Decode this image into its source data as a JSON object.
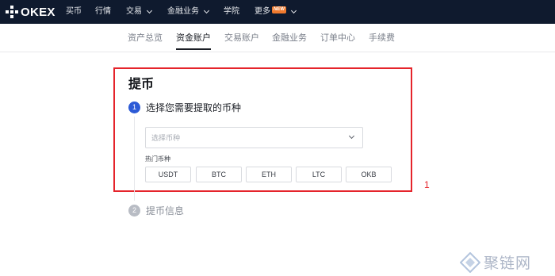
{
  "topnav": {
    "logo_text": "OKEX",
    "items": [
      {
        "label": "买币"
      },
      {
        "label": "行情"
      },
      {
        "label": "交易"
      },
      {
        "label": "金融业务"
      },
      {
        "label": "学院"
      },
      {
        "label": "更多"
      }
    ],
    "new_badge": "NEW"
  },
  "subnav": {
    "tabs": [
      {
        "label": "资产总览"
      },
      {
        "label": "资金账户",
        "active": true
      },
      {
        "label": "交易账户"
      },
      {
        "label": "金融业务"
      },
      {
        "label": "订单中心"
      },
      {
        "label": "手续费"
      }
    ]
  },
  "withdraw": {
    "title": "提币",
    "step1": {
      "number": "1",
      "label": "选择您需要提取的币种"
    },
    "select": {
      "placeholder": "选择币种"
    },
    "hot_label": "热门币种",
    "coins": [
      "USDT",
      "BTC",
      "ETH",
      "LTC",
      "OKB"
    ],
    "step2": {
      "number": "2",
      "label": "提币信息"
    }
  },
  "annotation": "1",
  "watermark": "聚链网",
  "colors": {
    "nav_bg": "#0f1a2e",
    "step_active": "#2c5ad6",
    "step_inactive": "#b8bcc4",
    "highlight_border": "#e5242b",
    "new_badge": "#f07a2e"
  }
}
